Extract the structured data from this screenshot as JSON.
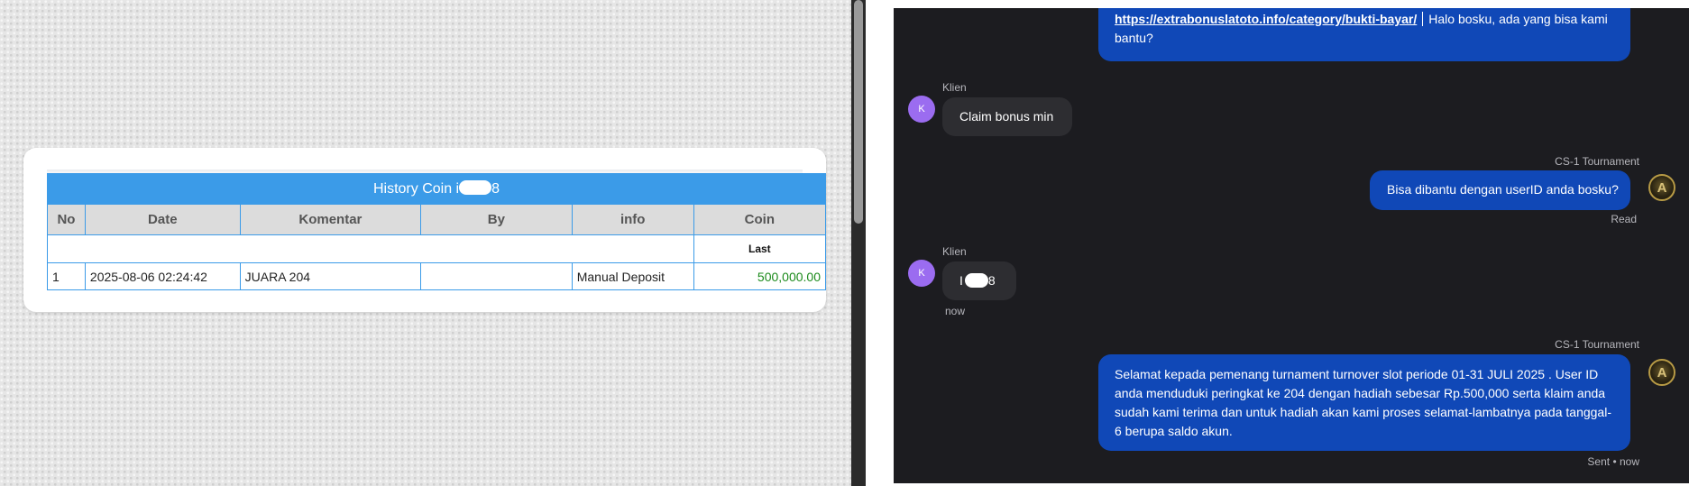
{
  "coin_history": {
    "title": "History Coin i",
    "title_suffix": "8",
    "columns": [
      "No",
      "Date",
      "Komentar",
      "By",
      "info",
      "Coin"
    ],
    "summary_label": "Last",
    "rows": [
      {
        "no": "1",
        "date": "2025-08-06 02:24:42",
        "komentar": "JUARA 204",
        "by": "",
        "info": "Manual Deposit",
        "coin": "500,000.00"
      }
    ]
  },
  "chat": {
    "messages": [
      {
        "link": "https://extrabonuslatoto.info/category/bukti-bayar/",
        "text": "Halo bosku, ada yang bisa kami bantu?"
      },
      {
        "sender": "Klien",
        "avatar": "K",
        "text": "Claim bonus min"
      },
      {
        "sender": "CS-1 Tournament",
        "avatar": "A",
        "text": "Bisa dibantu dengan userID anda bosku?",
        "status": "Read"
      },
      {
        "sender": "Klien",
        "avatar": "K",
        "text_prefix": "I",
        "text_suffix": "8",
        "time": "now"
      },
      {
        "sender": "CS-1 Tournament",
        "avatar": "A",
        "text": "Selamat kepada pemenang turnament turnover slot periode 01-31 JULI 2025 . User ID anda menduduki peringkat ke 204 dengan hadiah sebesar Rp.500,000 serta klaim anda sudah kami terima dan untuk hadiah akan kami proses selamat-lambatnya pada tanggal-6 berupa saldo akun.",
        "status": "Sent • now"
      }
    ]
  },
  "colors": {
    "table_header": "#3b9be8",
    "agent_bubble": "#1048b7",
    "client_bubble": "#2d2d31",
    "chat_background": "#1c1c20",
    "client_avatar": "#9b6cf0",
    "coin_positive": "#1b8a1b"
  }
}
